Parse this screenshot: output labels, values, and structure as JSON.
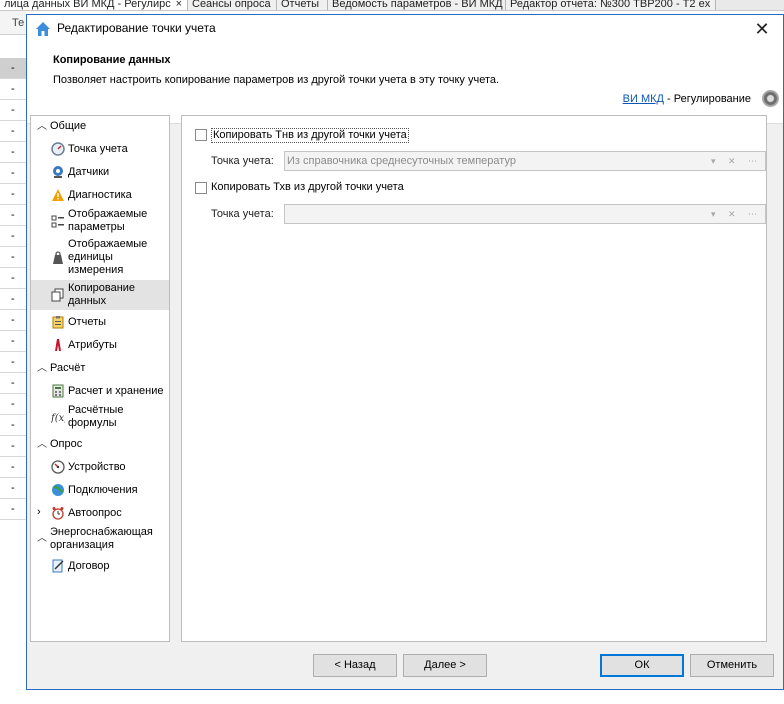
{
  "background": {
    "tabs": [
      {
        "label": "лица данных ВИ МКД - Регулирс",
        "close": "×"
      },
      {
        "label": "Сеансы опроса"
      },
      {
        "label": "Отчеты"
      },
      {
        "label": "Ведомость параметров - ВИ МКД"
      },
      {
        "label": "Редактор отчета: №300 ТВР200 - Т2 ex"
      }
    ],
    "column_header": "Те",
    "row_values": [
      "-",
      "-",
      "-",
      "-",
      "-",
      "-",
      "-",
      "-",
      "-",
      "-",
      "-",
      "-",
      "-",
      "-",
      "-",
      "-",
      "-",
      "-",
      "-",
      "-",
      "-",
      "-"
    ]
  },
  "dialog": {
    "title": "Редактирование точки учета",
    "close_glyph": "✕",
    "banner": {
      "title": "Копирование данных",
      "description": "Позволяет настроить копирование параметров из другой точки учета в эту точку учета.",
      "link_text": "ВИ МКД",
      "link_suffix": " - Регулирование"
    },
    "nav": {
      "groups": [
        {
          "label": "Общие",
          "items": [
            "Точка учета",
            "Датчики",
            "Диагностика",
            "Отображаемые параметры",
            "Отображаемые единицы измерения",
            "Копирование данных",
            "Отчеты",
            "Атрибуты"
          ]
        },
        {
          "label": "Расчёт",
          "items": [
            "Расчет и хранение",
            "Расчётные формулы"
          ]
        },
        {
          "label": "Опрос",
          "items": [
            "Устройство",
            "Подключения",
            "Автоопрос"
          ]
        },
        {
          "label": "Энергоснабжающая организация",
          "items": [
            "Договор"
          ]
        }
      ],
      "selected": "Копирование данных"
    },
    "content": {
      "copy_tnv_label": "Копировать Тнв из другой точки учета",
      "copy_tnv_checked": false,
      "tnv_point_label": "Точка учета:",
      "tnv_point_value": "Из справочника среднесуточных температур",
      "copy_txv_label": "Копировать Тхв из другой точки учета",
      "copy_txv_checked": false,
      "txv_point_label": "Точка учета:",
      "txv_point_value": "",
      "combo_buttons": "▾ ✕ ⋯"
    },
    "footer": {
      "back": "< Назад",
      "next": "Далее >",
      "ok": "ОК",
      "cancel": "Отменить"
    }
  }
}
